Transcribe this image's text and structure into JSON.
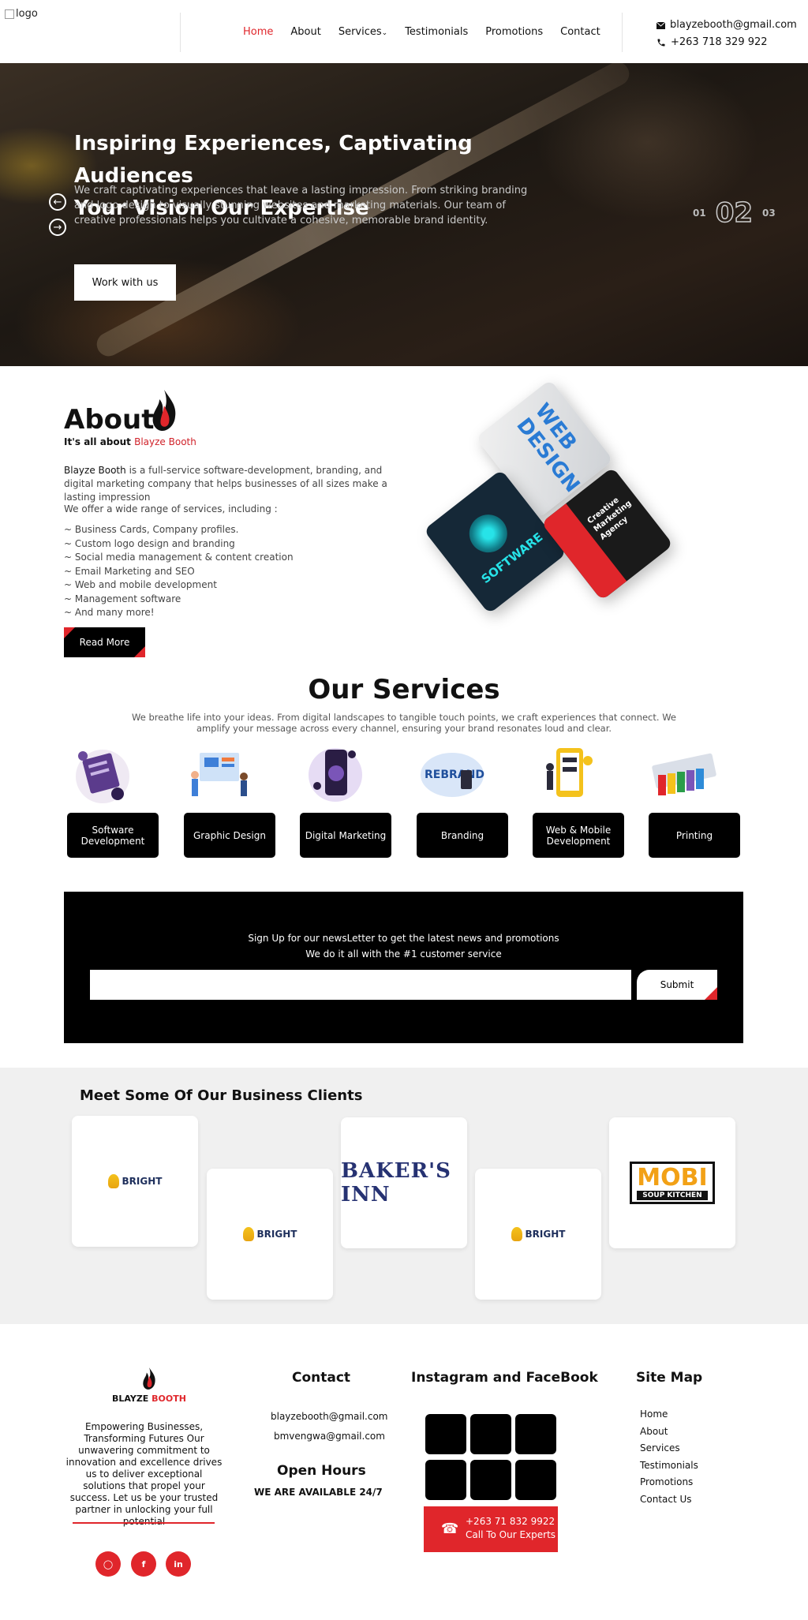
{
  "header": {
    "logo_alt": "logo",
    "nav": [
      {
        "label": "Home",
        "active": true
      },
      {
        "label": "About"
      },
      {
        "label": "Services",
        "has_dropdown": true
      },
      {
        "label": "Testimonials"
      },
      {
        "label": "Promotions"
      },
      {
        "label": "Contact"
      }
    ],
    "email": "blayzebooth@gmail.com",
    "phone": "+263 718 329 922"
  },
  "hero": {
    "title_line1": "Inspiring Experiences, Captivating Audiences",
    "title_line2": "Your Vision Our Expertise",
    "description": "We craft captivating experiences that leave a lasting impression. From striking branding and logo design to visually stunning websites and marketing materials. Our team of creative professionals helps you cultivate a cohesive, memorable brand identity.",
    "cta_label": "Work with us",
    "slide_prev": "01",
    "slide_current": "02",
    "slide_next": "03"
  },
  "about": {
    "title": "About",
    "subtitle_prefix": "It's all about",
    "subtitle_brand": "Blayze Booth",
    "desc_brand": "Blayze Booth",
    "desc_rest": " is a full-service software-development, branding, and digital marketing company that helps businesses of all sizes make a lasting impression",
    "offer_intro": "We offer a wide range of services, including :",
    "list": [
      "~ Business Cards, Company profiles.",
      "~ Custom logo design and branding",
      "~ Social media management & content creation",
      "~ Email Marketing and SEO",
      "~ Web and mobile development",
      "~ Management software",
      "~ And many more!"
    ],
    "read_more": "Read More",
    "card_web_text": "WEB DESIGN",
    "card_software_text": "SOFTWARE",
    "card_marketing_text": "Creative Marketing Agency"
  },
  "services": {
    "title": "Our Services",
    "subtitle": "We breathe life into your ideas. From digital landscapes to tangible touch points, we craft experiences that connect. We amplify your message across every channel, ensuring your brand resonates loud and clear.",
    "items": [
      {
        "label": "Software Development",
        "icon": "software-development-icon"
      },
      {
        "label": "Graphic Design",
        "icon": "graphic-design-icon"
      },
      {
        "label": "Digital Marketing",
        "icon": "digital-marketing-icon"
      },
      {
        "label": "Branding",
        "icon": "branding-icon",
        "icon_text": "REBRAND"
      },
      {
        "label": "Web & Mobile Development",
        "icon": "web-mobile-icon"
      },
      {
        "label": "Printing",
        "icon": "printing-icon"
      }
    ]
  },
  "newsletter": {
    "line1": "Sign Up for our newsLetter to get the latest news and promotions",
    "line2": "We do it all with the #1 customer service",
    "input_value": "",
    "submit_label": "Submit"
  },
  "clients": {
    "title": "Meet Some Of Our Business Clients",
    "logos": [
      {
        "name": "BRIGHT"
      },
      {
        "name": "BRIGHT"
      },
      {
        "name": "BAKER'S INN"
      },
      {
        "name": "BRIGHT"
      },
      {
        "name": "MOBI",
        "sub": "SOUP KITCHEN"
      }
    ]
  },
  "footer": {
    "brand_main": "BLAYZE",
    "brand_accent": "BOOTH",
    "tagline": "Empowering Businesses, Transforming Futures Our unwavering commitment to innovation and excellence drives us to deliver exceptional solutions that propel your success. Let us be your trusted partner in unlocking your full potential",
    "socials": [
      "instagram-icon",
      "facebook-icon",
      "linkedin-icon"
    ],
    "contact_title": "Contact",
    "email1": "blayzebooth@gmail.com",
    "email2": "bmvengwa@gmail.com",
    "hours_title": "Open Hours",
    "hours_text": "WE ARE AVAILABLE 24/7",
    "social_title": "Instagram and FaceBook",
    "call_number": "+263 71 832 9922",
    "call_text": "Call To Our Experts",
    "sitemap_title": "Site Map",
    "sitemap": [
      "Home",
      "About",
      "Services",
      "Testimonials",
      "Promotions",
      "Contact Us"
    ]
  },
  "colors": {
    "accent": "#e0262b",
    "dark": "#000000",
    "client_bg": "#f0f0f0"
  }
}
